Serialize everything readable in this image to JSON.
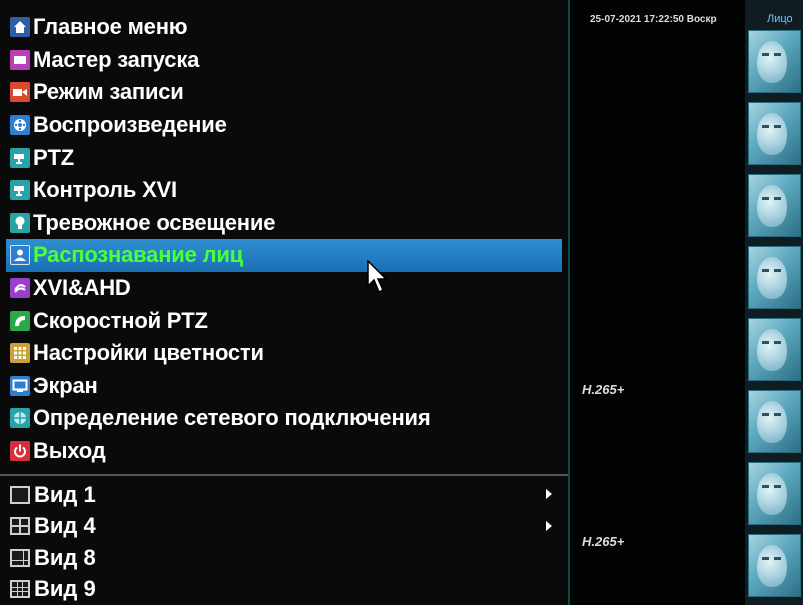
{
  "menu": {
    "items": [
      {
        "label": "Главное меню",
        "icon": "home-icon",
        "color": "#2c5fa8",
        "selected": false
      },
      {
        "label": "Мастер запуска",
        "icon": "wizard-icon",
        "color": "#b83fb8",
        "selected": false
      },
      {
        "label": "Режим записи",
        "icon": "record-icon",
        "color": "#d84a2e",
        "selected": false
      },
      {
        "label": "Воспроизведение",
        "icon": "playback-icon",
        "color": "#2f7fd0",
        "selected": false
      },
      {
        "label": "PTZ",
        "icon": "ptz-icon",
        "color": "#2aa3a8",
        "selected": false
      },
      {
        "label": "Контроль XVI",
        "icon": "xvi-control-icon",
        "color": "#2aa3a8",
        "selected": false
      },
      {
        "label": "Тревожное освещение",
        "icon": "alarm-light-icon",
        "color": "#2aa3a8",
        "selected": false
      },
      {
        "label": "Распознавание лиц",
        "icon": "face-recognition-icon",
        "color": "#2f7fd0",
        "selected": true
      },
      {
        "label": "XVI&AHD",
        "icon": "xvi-ahd-icon",
        "color": "#9a3fcc",
        "selected": false
      },
      {
        "label": "Скоростной PTZ",
        "icon": "speed-ptz-icon",
        "color": "#2aa84a",
        "selected": false
      },
      {
        "label": "Настройки цветности",
        "icon": "color-settings-icon",
        "color": "#c9a23a",
        "selected": false
      },
      {
        "label": "Экран",
        "icon": "screen-icon",
        "color": "#2f7fd0",
        "selected": false
      },
      {
        "label": "Определение сетевого подключения",
        "icon": "network-detect-icon",
        "color": "#2aa3a8",
        "selected": false
      },
      {
        "label": "Выход",
        "icon": "power-icon",
        "color": "#d8303a",
        "selected": false
      }
    ],
    "views": [
      {
        "label": "Вид 1",
        "icon": "view-1-icon",
        "has_submenu": true
      },
      {
        "label": "Вид 4",
        "icon": "view-4-icon",
        "has_submenu": true
      },
      {
        "label": "Вид 8",
        "icon": "view-8-icon",
        "has_submenu": false
      },
      {
        "label": "Вид 9",
        "icon": "view-9-icon",
        "has_submenu": false
      }
    ]
  },
  "video": {
    "datetime": "25-07-2021 17:22:50 Воскр",
    "codec_1": "H.265+",
    "codec_2": "H.265+",
    "faces_header": "Лицо"
  }
}
